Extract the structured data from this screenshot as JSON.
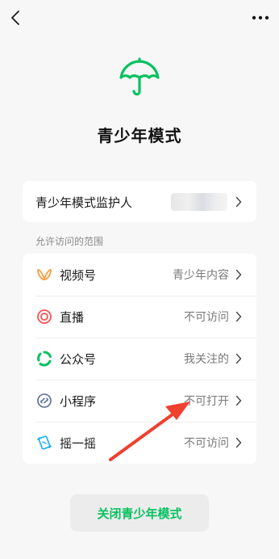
{
  "header": {
    "back_icon": "chevron-left-icon",
    "more_icon": "more-dots-icon"
  },
  "hero": {
    "icon": "umbrella-icon",
    "title": "青少年模式",
    "accent_color": "#07c160"
  },
  "guardian": {
    "label": "青少年模式监护人"
  },
  "scope": {
    "section_label": "允许访问的范围",
    "items": [
      {
        "label": "视频号",
        "value": "青少年内容",
        "icon": "channels-icon",
        "color": "#fa9d3b"
      },
      {
        "label": "直播",
        "value": "不可访问",
        "icon": "live-icon",
        "color": "#fa5151"
      },
      {
        "label": "公众号",
        "value": "我关注的",
        "icon": "official-accounts-icon",
        "color": "#07c160"
      },
      {
        "label": "小程序",
        "value": "不可打开",
        "icon": "mini-program-icon",
        "color": "#576b95"
      },
      {
        "label": "摇一摇",
        "value": "不可访问",
        "icon": "shake-icon",
        "color": "#10aeff"
      }
    ]
  },
  "footer": {
    "close_button": "关闭青少年模式"
  },
  "annotation": {
    "arrow_color": "#f0402e"
  }
}
